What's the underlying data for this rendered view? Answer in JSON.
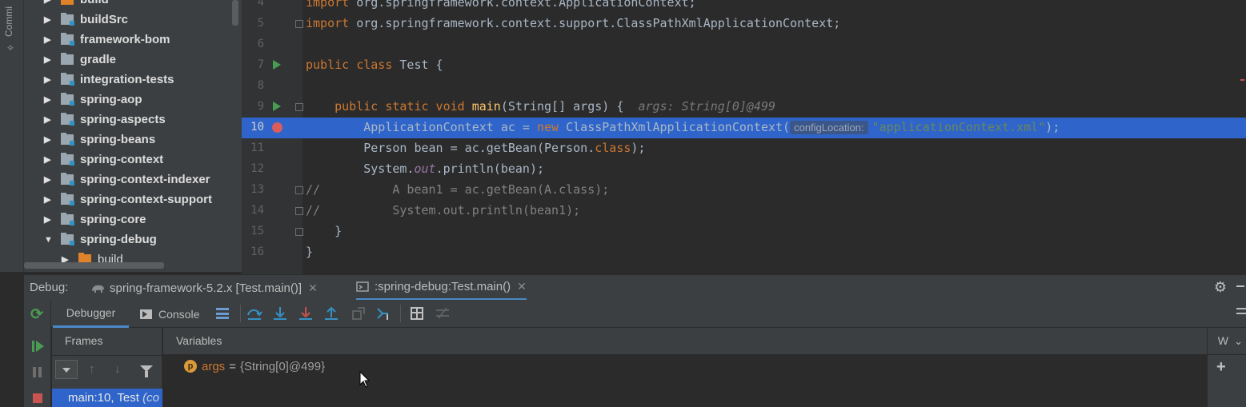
{
  "sidebar": {
    "commit_label": "Commi"
  },
  "project_tree": {
    "items": [
      {
        "label": "build",
        "type": "build",
        "expanded": false
      },
      {
        "label": "buildSrc",
        "type": "module",
        "expanded": false
      },
      {
        "label": "framework-bom",
        "type": "module",
        "expanded": false
      },
      {
        "label": "gradle",
        "type": "plain",
        "expanded": false
      },
      {
        "label": "integration-tests",
        "type": "module",
        "expanded": false
      },
      {
        "label": "spring-aop",
        "type": "module",
        "expanded": false
      },
      {
        "label": "spring-aspects",
        "type": "module",
        "expanded": false
      },
      {
        "label": "spring-beans",
        "type": "module",
        "expanded": false
      },
      {
        "label": "spring-context",
        "type": "module",
        "expanded": false
      },
      {
        "label": "spring-context-indexer",
        "type": "module",
        "expanded": false
      },
      {
        "label": "spring-context-support",
        "type": "module",
        "expanded": false
      },
      {
        "label": "spring-core",
        "type": "module",
        "expanded": false
      },
      {
        "label": "spring-debug",
        "type": "module",
        "expanded": true
      },
      {
        "label": "build",
        "type": "build",
        "expanded": false
      }
    ]
  },
  "editor": {
    "lines": [
      {
        "no": "4",
        "kw1": "import ",
        "rest": "org.springframework.context.ApplicationContext;"
      },
      {
        "no": "5",
        "kw1": "import ",
        "rest": "org.springframework.context.support.ClassPathXmlApplicationContext;"
      },
      {
        "no": "6"
      },
      {
        "no": "7",
        "kw1": "public class ",
        "rest": "Test {"
      },
      {
        "no": "8"
      },
      {
        "no": "9",
        "indent": "    ",
        "kw1": "public static void ",
        "fn": "main",
        "rest": "(String[] args) {  ",
        "hint": "args: String[0]@499"
      },
      {
        "no": "10",
        "indent": "        ",
        "pre": "ApplicationContext ac = ",
        "kw1": "new ",
        "rest": "ClassPathXmlApplicationContext(",
        "param_hint": "configLocation:",
        "str": "\"applicationContext.xml\"",
        "end": ");"
      },
      {
        "no": "11",
        "indent": "        ",
        "pre": "Person bean = ac.getBean(Person.",
        "kw1": "class",
        "end": ");"
      },
      {
        "no": "12",
        "indent": "        ",
        "pre": "System.",
        "italic": "out",
        "end": ".println(bean);"
      },
      {
        "no": "13",
        "comment": "//          A bean1 = ac.getBean(A.class);"
      },
      {
        "no": "14",
        "comment": "//          System.out.println(bean1);"
      },
      {
        "no": "15",
        "indent": "    ",
        "pre": "}"
      },
      {
        "no": "16",
        "pre": "}"
      }
    ]
  },
  "debug": {
    "title": "Debug:",
    "sessions": [
      {
        "label": "spring-framework-5.2.x [Test.main()]"
      },
      {
        "label": ":spring-debug:Test.main()"
      }
    ],
    "tabs": {
      "debugger": "Debugger",
      "console": "Console"
    },
    "frames": {
      "header": "Frames",
      "row_method": "main:10, Test ",
      "row_loc": "(co"
    },
    "variables": {
      "header": "Variables",
      "watches_header": "W",
      "rows": [
        {
          "badge": "p",
          "name": "args",
          "eq": "=",
          "value": "{String[0]@499}"
        }
      ]
    }
  },
  "colors": {
    "accent": "#2f65ca",
    "run": "#499c54",
    "breakpoint": "#db5c5c",
    "keyword": "#cc7832",
    "string": "#6a8759",
    "function": "#ffc66d"
  }
}
